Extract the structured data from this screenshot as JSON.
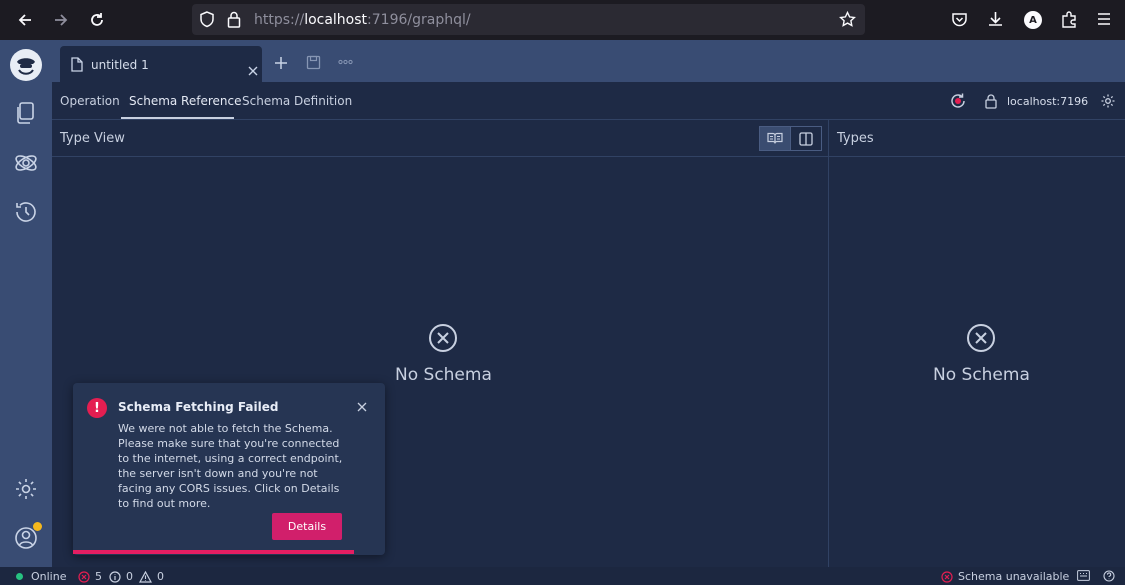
{
  "browser": {
    "url_scheme": "https://",
    "url_host": "localhost",
    "url_rest": ":7196/graphql/",
    "account_initial": "A"
  },
  "tabs": {
    "active_label": "untitled 1"
  },
  "subtabs": [
    {
      "label": "Operation"
    },
    {
      "label": "Schema Reference"
    },
    {
      "label": "Schema Definition"
    }
  ],
  "endpoint": "localhost:7196",
  "type_view": {
    "title": "Type View",
    "empty_label": "No Schema"
  },
  "types": {
    "title": "Types",
    "empty_label": "No Schema"
  },
  "toast": {
    "title": "Schema Fetching Failed",
    "message": "We were not able to fetch the Schema. Please make sure that you're connected to the internet, using a correct endpoint, the server isn't down and you're not facing any CORS issues. Click on Details to find out more.",
    "button_label": "Details",
    "progress": 0.9
  },
  "status": {
    "online_label": "Online",
    "errors": "5",
    "infos": "0",
    "warnings": "0",
    "schema_status": "Schema unavailable"
  },
  "colors": {
    "accent": "#d11f6b",
    "error": "#e41e51",
    "online": "#27c281",
    "notification_dot": "#f5b81d"
  }
}
